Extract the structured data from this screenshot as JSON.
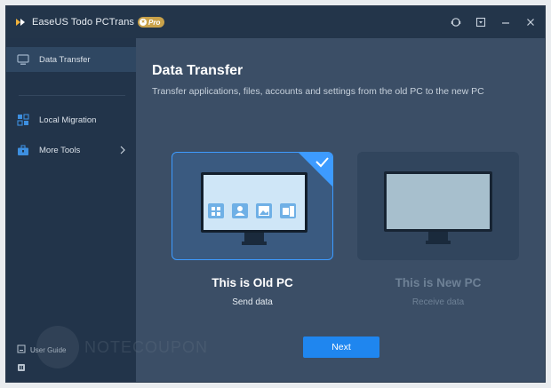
{
  "titlebar": {
    "app_name": "EaseUS Todo PCTrans",
    "badge": "Pro",
    "icons": [
      "support-icon",
      "menu-dropdown-icon",
      "minimize-icon",
      "close-icon"
    ]
  },
  "sidebar": {
    "items": [
      {
        "label": "Data Transfer",
        "icon": "monitor-icon",
        "active": true
      },
      {
        "label": "Local Migration",
        "icon": "migration-icon",
        "active": false
      },
      {
        "label": "More Tools",
        "icon": "toolbox-icon",
        "active": false
      }
    ],
    "user_guide": "User Guide"
  },
  "main": {
    "title": "Data Transfer",
    "description": "Transfer applications, files, accounts and settings from the old PC to the new PC",
    "cards": [
      {
        "title": "This is Old PC",
        "subtitle": "Send data",
        "selected": true
      },
      {
        "title": "This is New PC",
        "subtitle": "Receive data",
        "selected": false
      }
    ],
    "next_label": "Next"
  },
  "watermark": {
    "text": "NOTECOUPON"
  },
  "colors": {
    "accent": "#1f86ef",
    "selected_border": "#3d9bff",
    "sidebar_bg": "#22344a",
    "main_bg": "#3b4e66"
  }
}
